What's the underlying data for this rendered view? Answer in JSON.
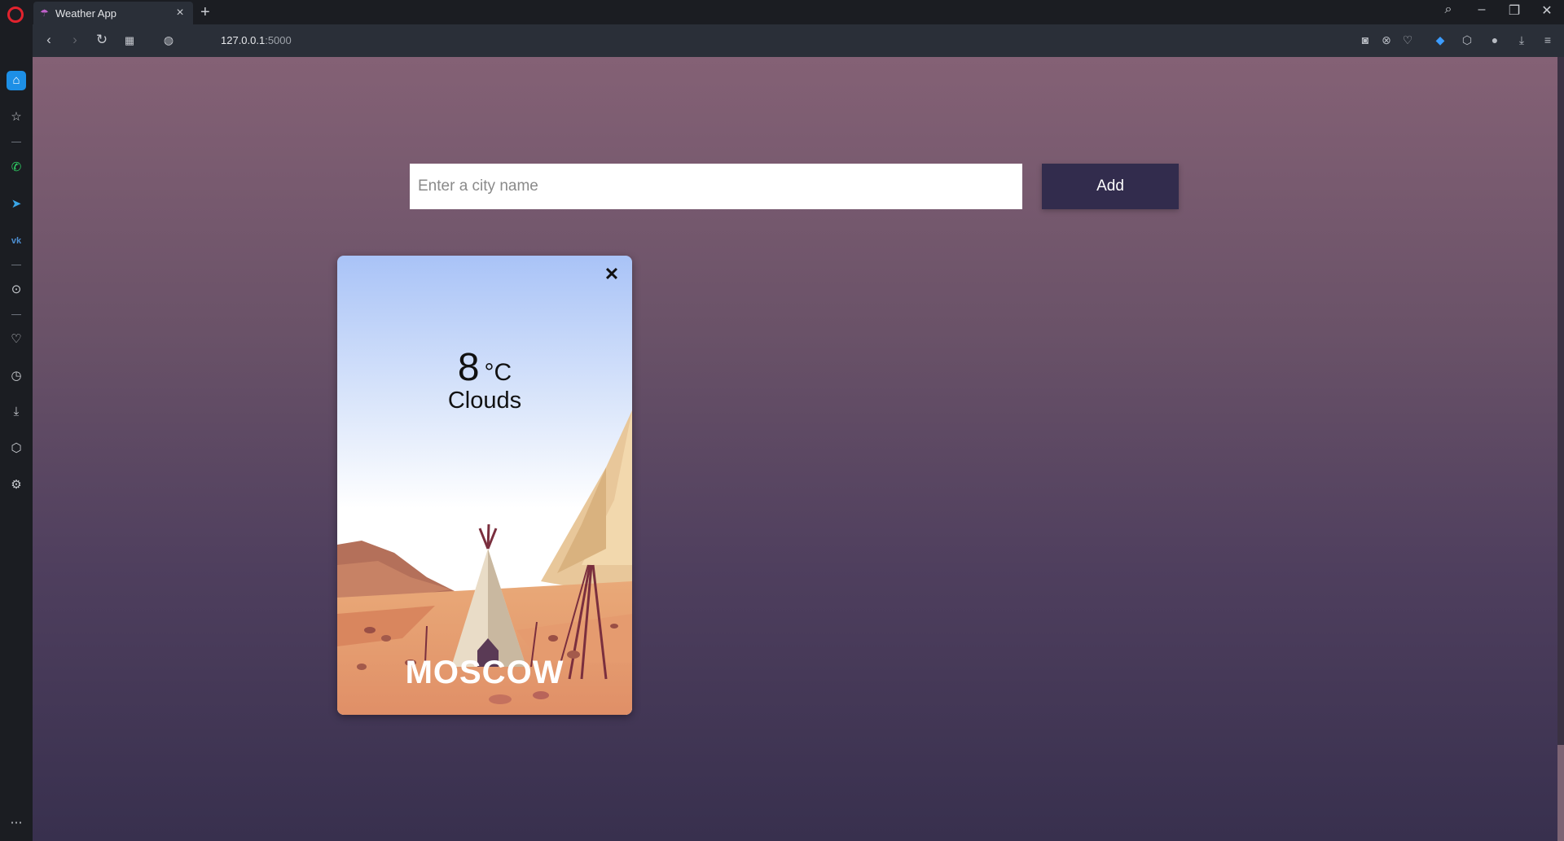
{
  "browser": {
    "tab_title": "Weather App",
    "tab_close": "×",
    "new_tab": "+",
    "url_host": "127.0.0.1",
    "url_port": ":5000"
  },
  "search": {
    "placeholder": "Enter a city name",
    "value": ""
  },
  "add_button_label": "Add",
  "card": {
    "close_label": "✕",
    "temperature": "8",
    "unit": "°C",
    "condition": "Clouds",
    "city": "MOSCOW"
  }
}
